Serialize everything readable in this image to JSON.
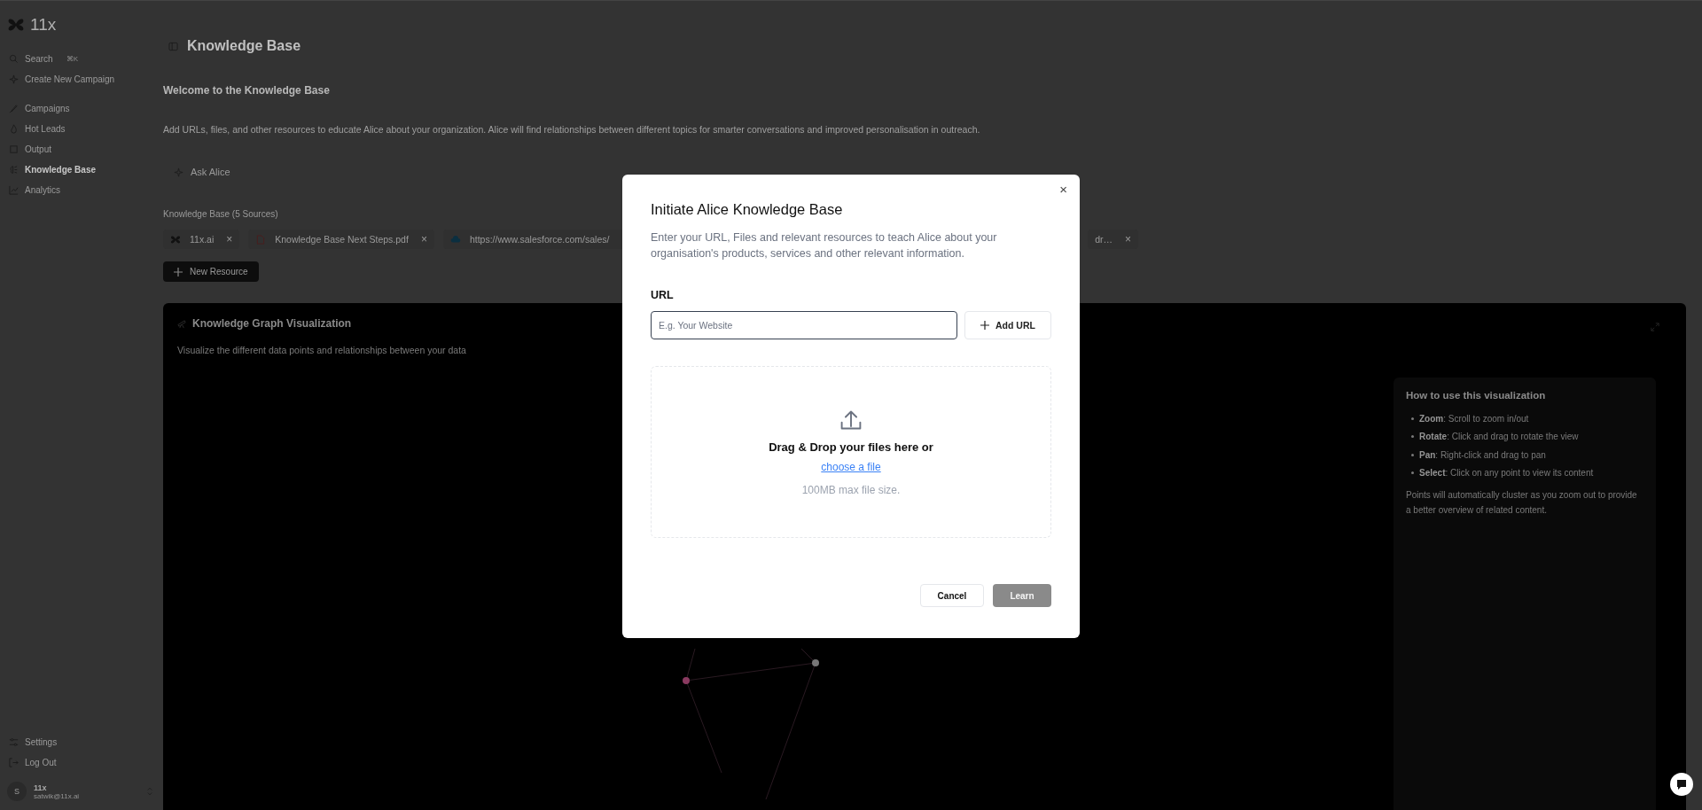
{
  "sidebar": {
    "logo": "11x",
    "search": {
      "label": "Search",
      "shortcut": "⌘K"
    },
    "primary": [
      {
        "label": "Create New Campaign",
        "selected": false
      }
    ],
    "items": [
      {
        "label": "Campaigns",
        "selected": false
      },
      {
        "label": "Hot Leads",
        "selected": false
      },
      {
        "label": "Output",
        "selected": false
      },
      {
        "label": "Knowledge Base",
        "selected": true
      },
      {
        "label": "Analytics",
        "selected": false
      }
    ],
    "footer": [
      {
        "label": "Settings"
      },
      {
        "label": "Log Out"
      }
    ],
    "user": {
      "initial": "S",
      "name": "11x",
      "email": "satwik@11x.ai"
    }
  },
  "page": {
    "title": "Knowledge Base",
    "heading": "Welcome to the Knowledge Base",
    "description": "Add URLs, files, and other resources to educate Alice about your organization. Alice will find relationships between different topics for smarter conversations and improved personalisation in outreach.",
    "ask_button": "Ask Alice",
    "sources_label": "Knowledge Base (5 Sources)",
    "sources": [
      {
        "kind": "logo",
        "label": "11x.ai",
        "close": "×"
      },
      {
        "kind": "pdf",
        "label": "Knowledge Base Next Steps.pdf",
        "close": "×"
      },
      {
        "kind": "cloud",
        "label": "https://www.salesforce.com/sales/"
      },
      {
        "kind": "tail",
        "label": "dr…",
        "close": "×"
      }
    ],
    "new_button": "New Resource"
  },
  "graph": {
    "title": "Knowledge Graph Visualization",
    "subtitle": "Visualize the different data points and relationships between your data",
    "help": {
      "title": "How to use this visualization",
      "items": [
        "**Zoom**: Scroll to zoom in/out",
        "**Rotate**: Click and drag to rotate the view",
        "**Pan**: Right-click and drag to pan",
        "**Select**: Click on any point to view its content"
      ],
      "note": "Points will automatically cluster as you zoom out to provide a better overview of related content."
    }
  },
  "modal": {
    "title": "Initiate Alice Knowledge Base",
    "close": "×",
    "description": "Enter your URL, Files and relevant resources to teach Alice about your organisation's products, services and other relevant information.",
    "url_label": "URL",
    "url_placeholder": "E.g. Your Website",
    "add_button": "Add URL",
    "drop_text": "Drag & Drop your files here or",
    "choose_link": "choose a file",
    "limit": "100MB max file size.",
    "cancel": "Cancel",
    "learn": "Learn",
    "learn_disabled": true
  }
}
